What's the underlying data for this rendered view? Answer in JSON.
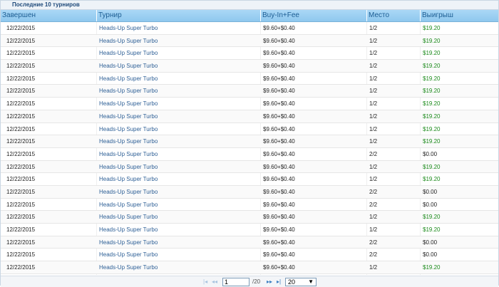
{
  "caption": "Последние 10 турниров",
  "columns": {
    "completed": "Завершен",
    "tournament": "Турнир",
    "buyin": "Buy-In+Fee",
    "place": "Место",
    "winnings": "Выигрыш"
  },
  "rows": [
    {
      "date": "12/22/2015",
      "tournament": "Heads-Up Super Turbo",
      "buyin": "$9.60+$0.40",
      "place": "1/2",
      "winnings": "$19.20"
    },
    {
      "date": "12/22/2015",
      "tournament": "Heads-Up Super Turbo",
      "buyin": "$9.60+$0.40",
      "place": "1/2",
      "winnings": "$19.20"
    },
    {
      "date": "12/22/2015",
      "tournament": "Heads-Up Super Turbo",
      "buyin": "$9.60+$0.40",
      "place": "1/2",
      "winnings": "$19.20"
    },
    {
      "date": "12/22/2015",
      "tournament": "Heads-Up Super Turbo",
      "buyin": "$9.60+$0.40",
      "place": "1/2",
      "winnings": "$19.20"
    },
    {
      "date": "12/22/2015",
      "tournament": "Heads-Up Super Turbo",
      "buyin": "$9.60+$0.40",
      "place": "1/2",
      "winnings": "$19.20"
    },
    {
      "date": "12/22/2015",
      "tournament": "Heads-Up Super Turbo",
      "buyin": "$9.60+$0.40",
      "place": "1/2",
      "winnings": "$19.20"
    },
    {
      "date": "12/22/2015",
      "tournament": "Heads-Up Super Turbo",
      "buyin": "$9.60+$0.40",
      "place": "1/2",
      "winnings": "$19.20"
    },
    {
      "date": "12/22/2015",
      "tournament": "Heads-Up Super Turbo",
      "buyin": "$9.60+$0.40",
      "place": "1/2",
      "winnings": "$19.20"
    },
    {
      "date": "12/22/2015",
      "tournament": "Heads-Up Super Turbo",
      "buyin": "$9.60+$0.40",
      "place": "1/2",
      "winnings": "$19.20"
    },
    {
      "date": "12/22/2015",
      "tournament": "Heads-Up Super Turbo",
      "buyin": "$9.60+$0.40",
      "place": "1/2",
      "winnings": "$19.20"
    },
    {
      "date": "12/22/2015",
      "tournament": "Heads-Up Super Turbo",
      "buyin": "$9.60+$0.40",
      "place": "2/2",
      "winnings": "$0.00"
    },
    {
      "date": "12/22/2015",
      "tournament": "Heads-Up Super Turbo",
      "buyin": "$9.60+$0.40",
      "place": "1/2",
      "winnings": "$19.20"
    },
    {
      "date": "12/22/2015",
      "tournament": "Heads-Up Super Turbo",
      "buyin": "$9.60+$0.40",
      "place": "1/2",
      "winnings": "$19.20"
    },
    {
      "date": "12/22/2015",
      "tournament": "Heads-Up Super Turbo",
      "buyin": "$9.60+$0.40",
      "place": "2/2",
      "winnings": "$0.00"
    },
    {
      "date": "12/22/2015",
      "tournament": "Heads-Up Super Turbo",
      "buyin": "$9.60+$0.40",
      "place": "2/2",
      "winnings": "$0.00"
    },
    {
      "date": "12/22/2015",
      "tournament": "Heads-Up Super Turbo",
      "buyin": "$9.60+$0.40",
      "place": "1/2",
      "winnings": "$19.20"
    },
    {
      "date": "12/22/2015",
      "tournament": "Heads-Up Super Turbo",
      "buyin": "$9.60+$0.40",
      "place": "1/2",
      "winnings": "$19.20"
    },
    {
      "date": "12/22/2015",
      "tournament": "Heads-Up Super Turbo",
      "buyin": "$9.60+$0.40",
      "place": "2/2",
      "winnings": "$0.00"
    },
    {
      "date": "12/22/2015",
      "tournament": "Heads-Up Super Turbo",
      "buyin": "$9.60+$0.40",
      "place": "2/2",
      "winnings": "$0.00"
    },
    {
      "date": "12/22/2015",
      "tournament": "Heads-Up Super Turbo",
      "buyin": "$9.60+$0.40",
      "place": "1/2",
      "winnings": "$19.20"
    }
  ],
  "pager": {
    "first_icon": "first-page-icon",
    "prev_icon": "prev-page-icon",
    "next_icon": "next-page-icon",
    "last_icon": "last-page-icon",
    "current_page": "1",
    "total_pages": "/20",
    "page_size": "20"
  },
  "colors": {
    "header_bg": "#9fd0f2",
    "header_text": "#1c5d93",
    "link": "#2d5f96",
    "win": "#1a8a1a"
  }
}
